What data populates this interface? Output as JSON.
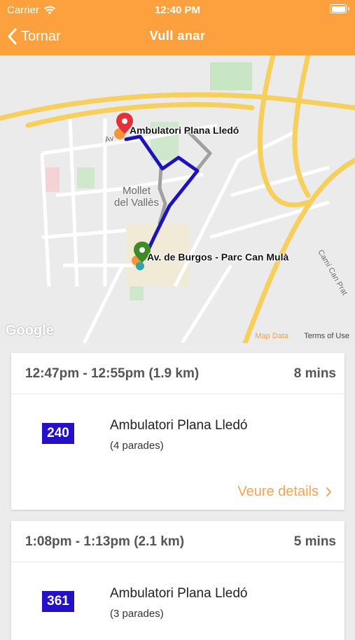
{
  "status_bar": {
    "carrier": "Carrier",
    "time": "12:40 PM"
  },
  "nav": {
    "back_label": "Tornar",
    "title": "Vull anar"
  },
  "map": {
    "destination_label": "Ambulatori Plana Lledó",
    "origin_label": "Av. de Burgos - Parc Can Mulà",
    "city_label_line1": "Mollet",
    "city_label_line2": "del Vallès",
    "street_label_1": "Av",
    "street_label_2": "Camí Can Prat",
    "google_logo": "Google",
    "map_data": "Map Data",
    "terms": "Terms of Use",
    "colors": {
      "route": "#1e13b8",
      "origin_pin": "#3d8a27",
      "destination_pin": "#e3303a",
      "highway": "#f6cf5d"
    }
  },
  "routes": [
    {
      "time_range": "12:47pm - 12:55pm (1.9 km)",
      "duration": "8 mins",
      "line": "240",
      "stop_name": "Ambulatori Plana Lledó",
      "stop_count": "(4 parades)",
      "details_label": "Veure details"
    },
    {
      "time_range": "1:08pm - 1:13pm (2.1 km)",
      "duration": "5 mins",
      "line": "361",
      "stop_name": "Ambulatori Plana Lledó",
      "stop_count": "(3 parades)"
    }
  ],
  "colors": {
    "header": "#fca13e",
    "line_badge": "#2310c7",
    "details_link": "#f5a457"
  }
}
